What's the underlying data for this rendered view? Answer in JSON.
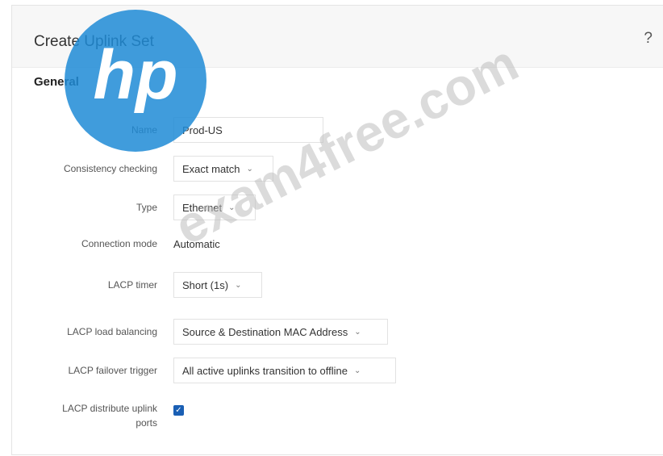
{
  "dialog": {
    "title": "Create Uplink Set",
    "help": "?"
  },
  "section": "General",
  "fields": {
    "name": {
      "label": "Name",
      "value": "Prod-US"
    },
    "consistency": {
      "label": "Consistency checking",
      "value": "Exact match"
    },
    "type": {
      "label": "Type",
      "value": "Ethernet"
    },
    "connection_mode": {
      "label": "Connection mode",
      "value": "Automatic"
    },
    "lacp_timer": {
      "label": "LACP timer",
      "value": "Short (1s)"
    },
    "lacp_load_balancing": {
      "label": "LACP load balancing",
      "value": "Source & Destination MAC Address"
    },
    "lacp_failover": {
      "label": "LACP failover trigger",
      "value": "All active uplinks transition to offline"
    },
    "lacp_distribute": {
      "label_line1": "LACP distribute uplink",
      "label_line2": "ports",
      "checked": true
    }
  },
  "watermark": {
    "text": "exam4free.com",
    "logo_text": "hp"
  },
  "colors": {
    "checkbox": "#1a5fb4",
    "logo": "#1f8bd6"
  }
}
